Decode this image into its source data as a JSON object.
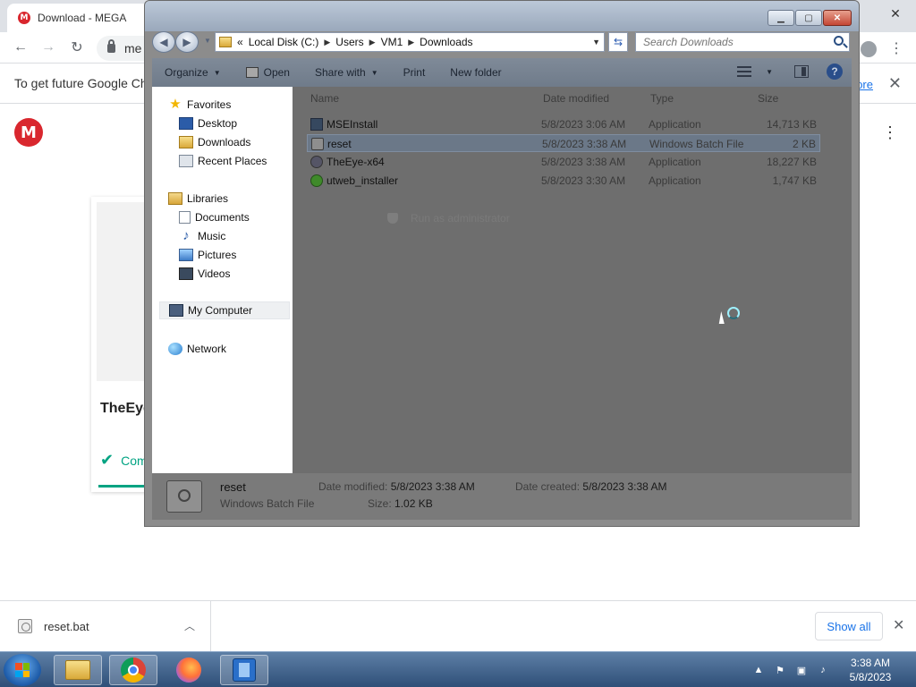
{
  "browser": {
    "tab_title": "Download - MEGA",
    "mega_letter": "M",
    "url_fragment": "me",
    "infobar_text": "To get future Google Chro",
    "infobar_link": "ore",
    "card_filename": "TheEye",
    "card_status": "Com"
  },
  "download_shelf": {
    "filename": "reset.bat",
    "show_all": "Show all"
  },
  "explorer": {
    "address": {
      "overflow": "«",
      "crumbs": [
        "Local Disk (C:)",
        "Users",
        "VM1",
        "Downloads"
      ]
    },
    "search_placeholder": "Search Downloads",
    "commands": {
      "organize": "Organize",
      "open": "Open",
      "share_with": "Share with",
      "print": "Print",
      "new_folder": "New folder"
    },
    "nav": {
      "favorites": "Favorites",
      "desktop": "Desktop",
      "downloads": "Downloads",
      "recent_places": "Recent Places",
      "libraries": "Libraries",
      "documents": "Documents",
      "music": "Music",
      "pictures": "Pictures",
      "videos": "Videos",
      "my_computer": "My Computer",
      "network": "Network"
    },
    "columns": {
      "name": "Name",
      "date": "Date modified",
      "type": "Type",
      "size": "Size"
    },
    "files": [
      {
        "name": "MSEInstall",
        "date": "5/8/2023 3:06 AM",
        "type": "Application",
        "size": "14,713 KB",
        "icon": "app-icon",
        "selected": false
      },
      {
        "name": "reset",
        "date": "5/8/2023 3:38 AM",
        "type": "Windows Batch File",
        "size": "2 KB",
        "icon": "batch-icon",
        "selected": true
      },
      {
        "name": "TheEye-x64",
        "date": "5/8/2023 3:38 AM",
        "type": "Application",
        "size": "18,227 KB",
        "icon": "eye-icon",
        "selected": false
      },
      {
        "name": "utweb_installer",
        "date": "5/8/2023 3:30 AM",
        "type": "Application",
        "size": "1,747 KB",
        "icon": "ut-icon",
        "selected": false
      }
    ],
    "ghost_menu_item": "Run as administrator",
    "details": {
      "name": "reset",
      "type": "Windows Batch File",
      "date_modified_label": "Date modified:",
      "date_modified": "5/8/2023 3:38 AM",
      "date_created_label": "Date created:",
      "date_created": "5/8/2023 3:38 AM",
      "size_label": "Size:",
      "size": "1.02 KB"
    }
  },
  "taskbar": {
    "clock_time": "3:38 AM",
    "clock_date": "5/8/2023"
  }
}
